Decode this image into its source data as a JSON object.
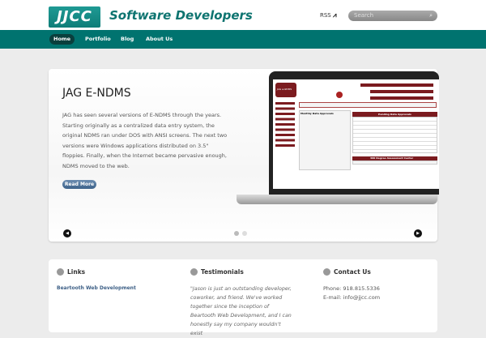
{
  "header": {
    "logo": "JJCC",
    "site_title": "Software Developers",
    "rss_label": "RSS",
    "search_placeholder": "Search"
  },
  "nav": [
    {
      "label": "Home"
    },
    {
      "label": "Portfolio"
    },
    {
      "label": "Blog"
    },
    {
      "label": "About Us"
    }
  ],
  "slider": {
    "title": "JAG E-NDMS",
    "description": "JAG has seen several versions of E-NDMS through the years. Starting originally as a centralized data entry system, the original NDMS ran under DOS with ANSI screens. The next two versions were Windows applications distributed on 3.5\" floppies. Finally, when the Internet became pervasive enough, NDMS moved to the web.",
    "button": "Read More",
    "slides": 2,
    "active_slide": 1,
    "screen": {
      "logo": "JAG e-NDMS",
      "pending_header": "Pending Data Approvals",
      "assessment_header": "360 Degree Assessment Center",
      "monthly": "Monthly Data Approvals"
    }
  },
  "sections": {
    "links": {
      "title": "Links",
      "items": [
        "Beartooth Web Development"
      ]
    },
    "testimonials": {
      "title": "Testimonials",
      "quote": "\"Jason is just an outstanding developer, coworker, and friend. We've worked together since the inception of Beartooth Web Development, and I can honestly say my company wouldn't exist"
    },
    "contact": {
      "title": "Contact Us",
      "phone": "Phone: 918.815.5336",
      "email": "E-mail: info@jjcc.com"
    }
  }
}
